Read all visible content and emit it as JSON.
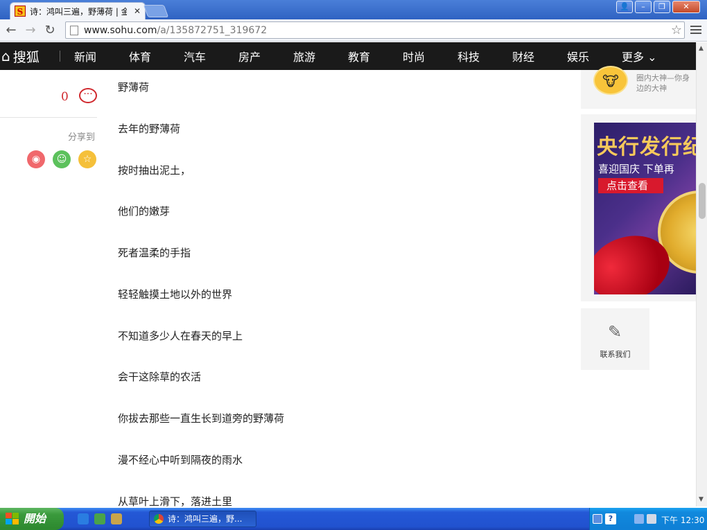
{
  "browser": {
    "tab_title": "诗：鸿叫三遍，野薄荷 | 金",
    "url_host": "www.sohu.com",
    "url_path": "/a/135872751_319672"
  },
  "site": {
    "logo": "搜狐",
    "nav": [
      "新闻",
      "体育",
      "汽车",
      "房产",
      "旅游",
      "教育",
      "时尚",
      "科技",
      "财经",
      "娱乐"
    ],
    "more": "更多"
  },
  "left": {
    "count": "0",
    "share_label": "分享到"
  },
  "article": {
    "paragraphs": [
      "野薄荷",
      "去年的野薄荷",
      "按时抽出泥土，",
      "他们的嫩芽",
      "死者温柔的手指",
      "轻轻触摸土地以外的世界",
      "不知道多少人在春天的早上",
      "会干这除草的农活",
      "你拔去那些一直生长到道旁的野薄荷",
      "漫不经心中听到隔夜的雨水",
      "从草叶上滑下，落进土里"
    ]
  },
  "right": {
    "author_desc": "圈内大神—你身边的大神",
    "ad": {
      "title": "央行发行纪",
      "subtitle": "喜迎国庆 下单再",
      "button": "点击查看"
    },
    "contact": "联系我们"
  },
  "taskbar": {
    "start": "開始",
    "task_title": "诗：鸿叫三遍，野...",
    "clock": "下午 12:30"
  },
  "colors": {
    "nav_bg": "#1a1a1a",
    "accent_red": "#d0282d",
    "weibo": "#f0686c",
    "wechat": "#5cc15c",
    "favorite": "#f5c03a"
  }
}
